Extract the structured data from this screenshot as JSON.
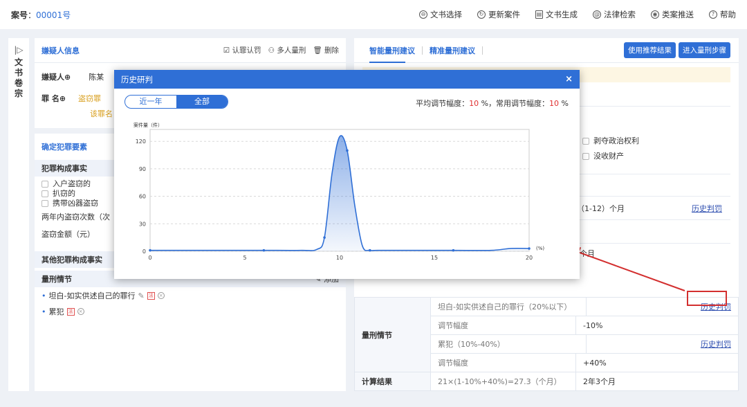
{
  "header": {
    "case_label": "案号",
    "case_sep": "：",
    "case_no": "00001号",
    "actions": [
      {
        "icon": "document-select-icon",
        "glyph": "⊖",
        "label": "文书选择"
      },
      {
        "icon": "refresh-case-icon",
        "glyph": "↻",
        "label": "更新案件"
      },
      {
        "icon": "document-generate-icon",
        "glyph": "▤",
        "label": "文书生成"
      },
      {
        "icon": "law-search-icon",
        "glyph": "@",
        "label": "法律检索"
      },
      {
        "icon": "case-push-icon",
        "glyph": "◉",
        "label": "类案推送"
      },
      {
        "icon": "help-icon",
        "glyph": "?",
        "label": "帮助"
      }
    ]
  },
  "sidetab": {
    "arrow": "|▷",
    "label": "文书卷宗"
  },
  "left": {
    "suspect_title": "嫌疑人信息",
    "suspect_actions": [
      "认罪认罚",
      "多人量刑",
      "删除"
    ],
    "suspect_label": "嫌疑人⊕",
    "suspect_name": "陈某",
    "charge_label": "罪  名⊕",
    "charge_1": "盗窃罪",
    "charge_2": "该罪名",
    "elements_title": "确定犯罪要素",
    "facts_title": "犯罪构成事实",
    "facts": [
      "入户盗窃的",
      "扒窃的",
      "携带凶器盗窃"
    ],
    "two_year_label": "两年内盗窃次数（次",
    "amount_label": "盗窃金额（元）",
    "other_facts": "其他犯罪构成事实",
    "add": "添加",
    "circumstances": "量刑情节",
    "items": [
      "坦白-如实供述自己的罪行",
      "累犯"
    ]
  },
  "right": {
    "tab_smart": "智能量刑建议",
    "tab_precise": "精准量刑建议",
    "btn_use": "使用推荐结果",
    "btn_enter": "进入量刑步骤",
    "options": [
      "剥夺政治权利",
      "没收财产"
    ],
    "range": "（1-12）个月",
    "history": "历史判罚",
    "month_tail": "个月",
    "table": {
      "circ_label": "量刑情节",
      "r1": "坦白-如实供述自己的罪行（20%以下）",
      "r2_label": "调节幅度",
      "r2_val": "-10%",
      "r3": "累犯（10%-40%）",
      "r4_label": "调节幅度",
      "r4_val": "+40%",
      "calc_label": "计算结果",
      "calc_expr": "21×(1-10%+40%)=27.3（个月）",
      "calc_result": "2年3个月"
    }
  },
  "modal": {
    "title": "历史研判",
    "close": "×",
    "toggle": [
      "近一年",
      "全部"
    ],
    "stat_prefix": "平均调节幅度：",
    "stat_avg": "10",
    "stat_mid": " %，常用调节幅度：",
    "stat_common": "10",
    "stat_suffix": " %"
  },
  "chart_data": {
    "type": "area",
    "ylabel": "案件量（件）",
    "xlabel": "(%)",
    "xlim": [
      0,
      20
    ],
    "ylim": [
      0,
      130
    ],
    "xticks": [
      0,
      5,
      10,
      15,
      20
    ],
    "yticks": [
      0,
      30,
      60,
      90,
      120
    ],
    "x": [
      0,
      2,
      4,
      6,
      8,
      8.8,
      9.2,
      9.6,
      10.0,
      10.4,
      10.8,
      11.2,
      11.6,
      12,
      14,
      16,
      18,
      19,
      20
    ],
    "values": [
      1,
      1,
      1,
      1,
      1,
      2,
      15,
      85,
      125,
      110,
      50,
      6,
      1,
      1,
      1,
      1,
      1,
      3,
      3
    ],
    "color": "#2f6fd6"
  }
}
